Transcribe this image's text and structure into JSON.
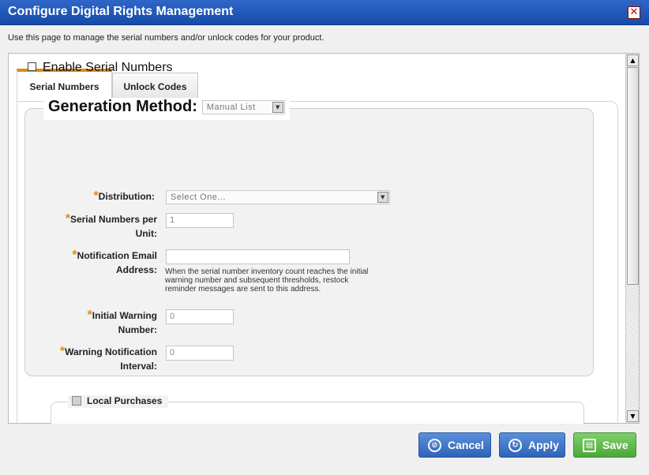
{
  "dialog": {
    "title": "Configure Digital Rights Management",
    "close_glyph": "✕",
    "intro": "Use this page to manage the serial numbers and/or unlock codes for your product."
  },
  "tabs": [
    {
      "label": "Serial Numbers",
      "active": true
    },
    {
      "label": "Unlock Codes",
      "active": false
    }
  ],
  "enable_serial": {
    "label": "Enable Serial Numbers",
    "checked": false
  },
  "generation": {
    "label": "Generation Method:",
    "selected": "Manual List"
  },
  "fields": {
    "distribution": {
      "label": "Distribution:",
      "required": true,
      "selected": "Select One..."
    },
    "serials_per_unit": {
      "label_line1": "Serial Numbers per",
      "label_line2": "Unit:",
      "required": true,
      "value": "1"
    },
    "notification_email": {
      "label_line1": "Notification Email",
      "label_line2": "Address:",
      "required": true,
      "value": "",
      "hint": "When the serial number inventory count reaches the initial warning number and subsequent thresholds, restock reminder messages are sent to this address."
    },
    "initial_warning": {
      "label_line1": "Initial Warning",
      "label_line2": "Number:",
      "required": true,
      "value": "0"
    },
    "warning_interval": {
      "label_line1": "Warning Notification",
      "label_line2": "Interval:",
      "required": true,
      "value": "0"
    }
  },
  "required_marker": "*",
  "local_purchases": {
    "label": "Local Purchases",
    "checked": false
  },
  "buttons": {
    "cancel": "Cancel",
    "apply": "Apply",
    "save": "Save"
  },
  "icons": {
    "cancel": "cancel-icon",
    "apply": "refresh-icon",
    "save": "floppy-icon"
  },
  "colors": {
    "titlebar": "#1e55b6",
    "tab_accent": "#e08a12",
    "required": "#e08a12",
    "primary_button": "#3f73c9",
    "save_button": "#5bb848"
  }
}
